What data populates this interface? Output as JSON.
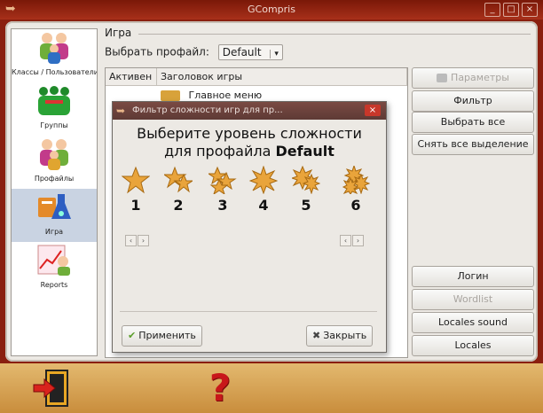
{
  "window": {
    "title": "GCompris"
  },
  "sidebar": {
    "items": [
      {
        "label": "Классы / Пользователи",
        "icon": "users-icon"
      },
      {
        "label": "Группы",
        "icon": "groups-icon"
      },
      {
        "label": "Профайлы",
        "icon": "profiles-icon"
      },
      {
        "label": "Игра",
        "icon": "game-icon"
      },
      {
        "label": "Reports",
        "icon": "reports-icon"
      }
    ]
  },
  "main": {
    "group_label": "Игра",
    "profile_label": "Выбрать профайл:",
    "profile_value": "Default",
    "columns": [
      "Активен",
      "Заголовок игры"
    ],
    "rows": [
      {
        "title": "Главное меню"
      }
    ],
    "buttons": {
      "params": "Параметры",
      "filter": "Фильтр",
      "select_all": "Выбрать все",
      "deselect_all": "Снять все выделение",
      "login": "Логин",
      "wordlist": "Wordlist",
      "locales_sound": "Locales sound",
      "locales": "Locales"
    }
  },
  "dialog": {
    "title": "Фильтр сложности игр для пр...",
    "heading_line1": "Выберите уровень сложности",
    "heading_line2_prefix": "для профайла",
    "heading_profile": "Default",
    "levels": [
      "1",
      "2",
      "3",
      "4",
      "5",
      "6"
    ],
    "apply_label": "Применить",
    "close_label": "Закрыть"
  },
  "colors": {
    "accent": "#c8171a",
    "star": "#e9a43b"
  }
}
